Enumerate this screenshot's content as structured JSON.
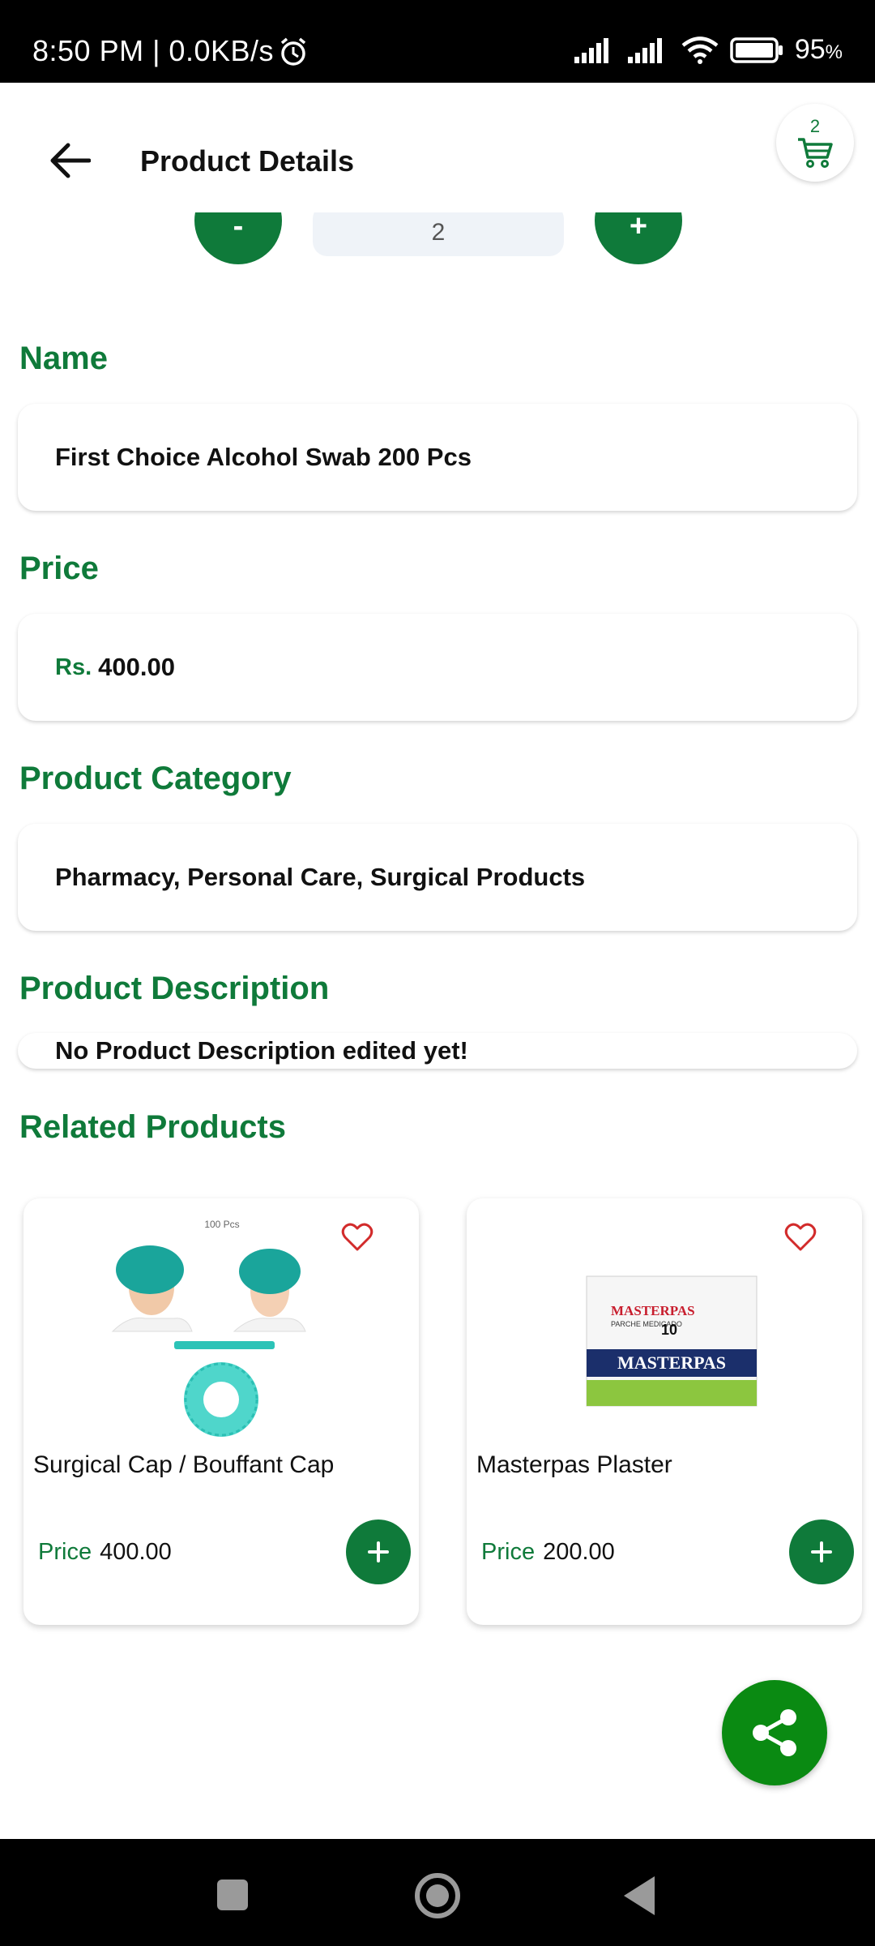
{
  "status_bar": {
    "time_speed": "8:50 PM | 0.0KB/s",
    "battery_value": "95",
    "battery_unit": "%"
  },
  "header": {
    "title": "Product Details",
    "cart_count": "2"
  },
  "quantity": {
    "minus_label": "-",
    "plus_label": "+",
    "value": "2"
  },
  "sections": {
    "name_label": "Name",
    "name_value": "First Choice Alcohol Swab 200 Pcs",
    "price_label": "Price",
    "price_currency": "Rs.",
    "price_value": "400.00",
    "category_label": "Product Category",
    "category_value": "Pharmacy, Personal Care, Surgical Products",
    "description_label": "Product Description",
    "description_value": "No Product Description edited yet!",
    "related_label": "Related Products"
  },
  "related_products": [
    {
      "name": "Surgical Cap / Bouffant Cap",
      "price_label": "Price",
      "price": "400.00",
      "image_caption": "100 Pcs"
    },
    {
      "name": "Masterpas Plaster",
      "price_label": "Price",
      "price": "200.00",
      "image_brand": "MASTERPAS",
      "image_sub": "PARCHE MEDICADO",
      "image_count": "10"
    }
  ],
  "icons": {
    "back": "arrow-left-icon",
    "cart": "cart-icon",
    "heart": "heart-outline-icon",
    "add": "plus-icon",
    "share": "share-icon"
  },
  "colors": {
    "accent_green": "#0f7a3a",
    "fab_green": "#0a8a12",
    "heart_red": "#d22b2b"
  }
}
